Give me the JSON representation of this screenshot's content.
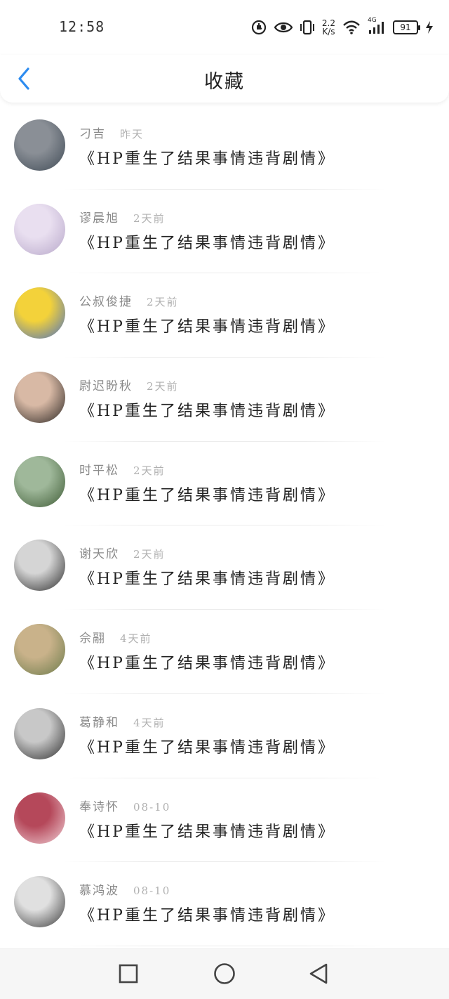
{
  "status_bar": {
    "time": "12:58",
    "speed_value": "2.2",
    "speed_unit": "K/s",
    "network": "4G",
    "battery": "91",
    "icons": [
      "data-saver-icon",
      "eye-icon",
      "vibrate-icon",
      "speed-icon",
      "wifi-icon",
      "signal-icon",
      "battery-icon",
      "charging-icon"
    ]
  },
  "header": {
    "title": "收藏",
    "back_icon": "chevron-left-icon",
    "accent_color": "#2d8cf0"
  },
  "list": {
    "items": [
      {
        "author": "刁吉",
        "time": "昨天",
        "title": "《HP重生了结果事情违背剧情》",
        "avatar_colors": [
          "#8a8f96",
          "#3f4a55"
        ]
      },
      {
        "author": "谬晨旭",
        "time": "2天前",
        "title": "《HP重生了结果事情违背剧情》",
        "avatar_colors": [
          "#e9dff0",
          "#b7a7c9"
        ]
      },
      {
        "author": "公叔俊捷",
        "time": "2天前",
        "title": "《HP重生了结果事情违背剧情》",
        "avatar_colors": [
          "#f3d23a",
          "#4a6fc2"
        ]
      },
      {
        "author": "尉迟盼秋",
        "time": "2天前",
        "title": "《HP重生了结果事情违背剧情》",
        "avatar_colors": [
          "#d8b9a5",
          "#2a2522"
        ]
      },
      {
        "author": "时平松",
        "time": "2天前",
        "title": "《HP重生了结果事情违背剧情》",
        "avatar_colors": [
          "#9fb89a",
          "#3d5a34"
        ]
      },
      {
        "author": "谢天欣",
        "time": "2天前",
        "title": "《HP重生了结果事情违背剧情》",
        "avatar_colors": [
          "#d5d5d5",
          "#2b2b2b"
        ]
      },
      {
        "author": "佘翮",
        "time": "4天前",
        "title": "《HP重生了结果事情违背剧情》",
        "avatar_colors": [
          "#c9b28a",
          "#6b7a4a"
        ]
      },
      {
        "author": "葛静和",
        "time": "4天前",
        "title": "《HP重生了结果事情违背剧情》",
        "avatar_colors": [
          "#c8c8c8",
          "#2e2e2e"
        ]
      },
      {
        "author": "奉诗怀",
        "time": "08-10",
        "title": "《HP重生了结果事情违背剧情》",
        "avatar_colors": [
          "#b5485a",
          "#f0d0d6"
        ]
      },
      {
        "author": "慕鸿波",
        "time": "08-10",
        "title": "《HP重生了结果事情违背剧情》",
        "avatar_colors": [
          "#e0e0e0",
          "#3a3a3a"
        ]
      }
    ]
  },
  "nav_bar": {
    "buttons": [
      "recent-apps-square-icon",
      "home-circle-icon",
      "back-triangle-icon"
    ]
  }
}
